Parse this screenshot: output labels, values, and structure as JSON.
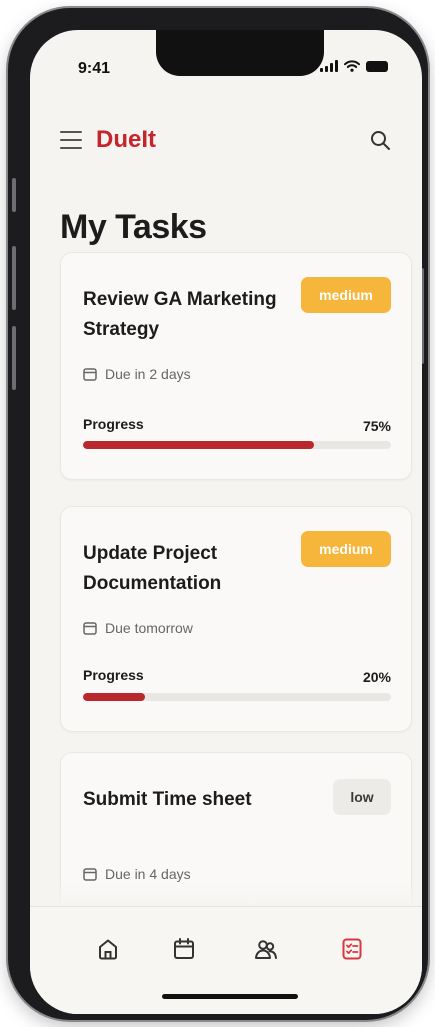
{
  "status_bar": {
    "time": "9:41"
  },
  "header": {
    "brand": "DueIt"
  },
  "page": {
    "title": "My Tasks"
  },
  "tasks": [
    {
      "title": "Review GA Marketing Strategy",
      "priority": "medium",
      "due": "Due in 2 days",
      "progress_label": "Progress",
      "progress_text": "75%",
      "progress": 0.75
    },
    {
      "title": "Update Project Documentation",
      "priority": "medium",
      "due": "Due tomorrow",
      "progress_label": "Progress",
      "progress_text": "20%",
      "progress": 0.2
    },
    {
      "title": "Submit Time sheet",
      "priority": "low",
      "due": "Due in 4 days"
    }
  ],
  "tab_bar": {
    "items": [
      {
        "icon": "home-icon",
        "active": false
      },
      {
        "icon": "calendar-icon",
        "active": false
      },
      {
        "icon": "team-icon",
        "active": false
      },
      {
        "icon": "tasks-icon",
        "active": true
      }
    ]
  },
  "colors": {
    "brand": "#c5262b",
    "progress_fill": "#b8282d",
    "medium_badge": "#f6b63c",
    "low_badge": "#ecebe8",
    "active_tab": "#d9363e"
  }
}
